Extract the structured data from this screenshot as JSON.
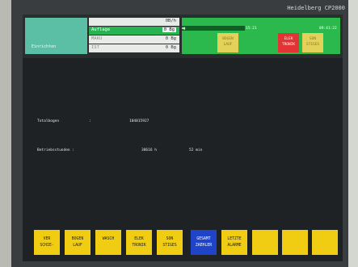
{
  "brand": "Heidelberg CP2000",
  "mode": {
    "label": "Einrichten"
  },
  "rates": {
    "unit": "0B/h",
    "rows": [
      {
        "label": "Auflage",
        "value": "0 Bg"
      },
      {
        "label": "MAKU",
        "value": "0 Bg"
      },
      {
        "label": "IST",
        "value": "0 Bg"
      }
    ]
  },
  "status": {
    "counter": "0",
    "progress": 0.05,
    "time_left": "15:21",
    "time_right": "09:41:22",
    "indicators": [
      {
        "line1": "BOGEN",
        "line2": "LAUF",
        "color": "#e3d15a"
      },
      {
        "line1": "ELEK",
        "line2": "TRONIK",
        "color": "#e23434"
      },
      {
        "line1": "SON",
        "line2": "STIGES",
        "color": "#e3d15a"
      }
    ]
  },
  "main": {
    "total_label": "Totalbogen",
    "total_sep": ":",
    "total_value": "104015927",
    "hours_label": "Betriebsstunden :",
    "hours_value": "38616 h",
    "minutes_value": "52 min"
  },
  "softkeys": [
    {
      "line1": "VER",
      "line2": "SCHIE-",
      "active": false
    },
    {
      "line1": "BOGEN",
      "line2": "LAUF",
      "active": false
    },
    {
      "line1": "WASCH",
      "line2": "",
      "active": false
    },
    {
      "line1": "ELEK",
      "line2": "TRONIK",
      "active": false
    },
    {
      "line1": "SON",
      "line2": "STIGES",
      "active": false
    },
    {
      "line1": "GESAMT",
      "line2": "ZAEHLER",
      "active": true
    },
    {
      "line1": "LETZTE",
      "line2": "ALARME",
      "active": false
    },
    {
      "line1": "",
      "line2": "",
      "active": false
    },
    {
      "line1": "",
      "line2": "",
      "active": false
    },
    {
      "line1": "",
      "line2": "",
      "active": false
    }
  ]
}
